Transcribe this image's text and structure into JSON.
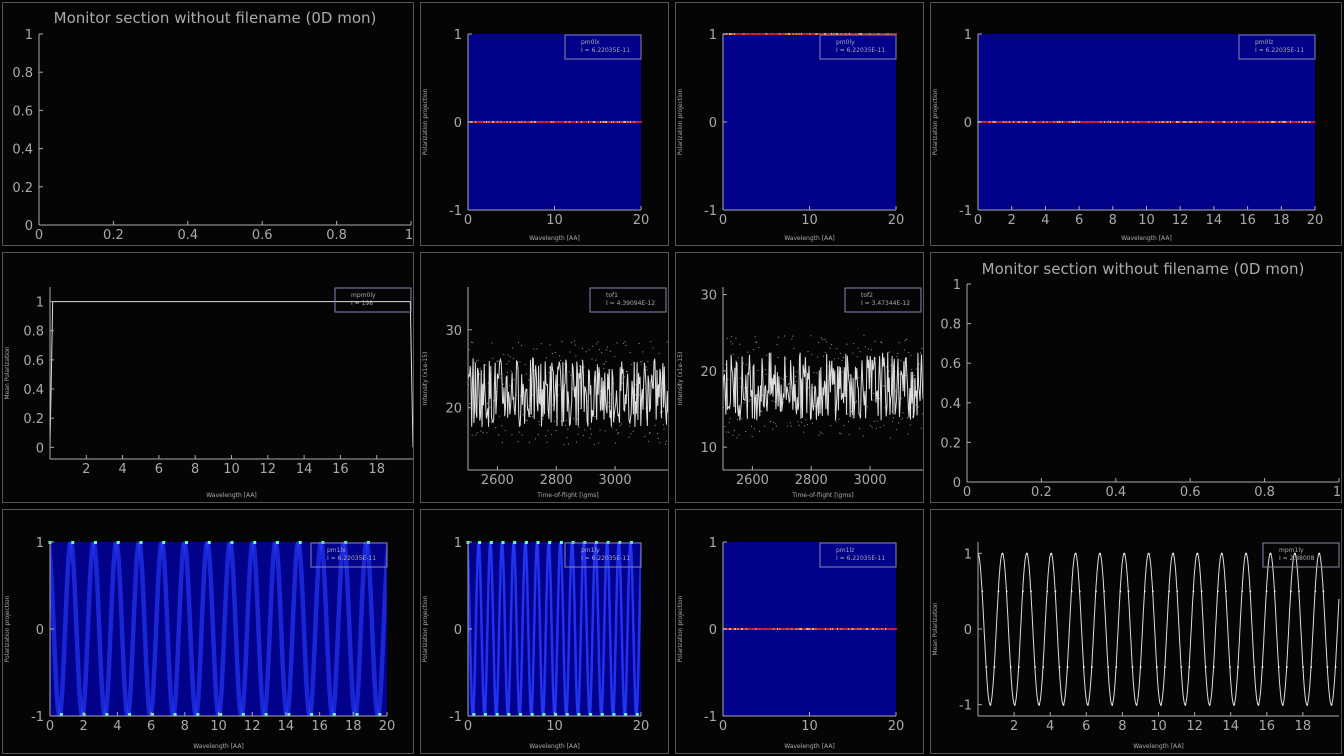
{
  "colors": {
    "background": "#000000",
    "axis": "#aaaaaa",
    "frame": "#555555",
    "heatmap_blue": "#01018a",
    "heatmap_red": "#ff2020",
    "polarization_blue": "#2a3cff",
    "line_white": "#dddddd"
  },
  "chart_data": [
    {
      "id": "p00",
      "type": "scatter",
      "title": "Monitor section without filename (0D mon)",
      "xlabel": "",
      "ylabel": "",
      "xlim": [
        0,
        1
      ],
      "ylim": [
        0,
        1
      ],
      "xticks": [
        "0",
        "0.2",
        "0.4",
        "0.6",
        "0.8",
        "1"
      ],
      "yticks": [
        "0",
        "0.2",
        "0.4",
        "0.6",
        "0.8",
        "1"
      ],
      "series": []
    },
    {
      "id": "p01",
      "type": "heatmap",
      "xlabel": "Wavelength [AA]",
      "ylabel": "Polarization projection",
      "xlim": [
        0,
        20
      ],
      "ylim": [
        -1,
        1
      ],
      "xticks": [
        "0",
        "10",
        "20"
      ],
      "yticks": [
        "-1",
        "0",
        "1"
      ],
      "legend": [
        "pm0lx",
        "I = 6.22035E-11"
      ],
      "legend_position": "top-right",
      "bands": [
        0
      ]
    },
    {
      "id": "p02",
      "type": "heatmap",
      "xlabel": "Wavelength [AA]",
      "ylabel": "Polarization projection",
      "xlim": [
        0,
        20
      ],
      "ylim": [
        -1,
        1
      ],
      "xticks": [
        "0",
        "10",
        "20"
      ],
      "yticks": [
        "-1",
        "0",
        "1"
      ],
      "legend": [
        "pm0ly",
        "I = 6.22035E-11"
      ],
      "legend_position": "top-right",
      "bands": [
        1
      ]
    },
    {
      "id": "p03",
      "type": "heatmap",
      "xlabel": "Wavelength [AA]",
      "ylabel": "Polarization projection",
      "xlim": [
        0,
        20
      ],
      "ylim": [
        -1,
        1
      ],
      "xticks": [
        "0",
        "2",
        "4",
        "6",
        "8",
        "10",
        "12",
        "14",
        "16",
        "18",
        "20"
      ],
      "yticks": [
        "-1",
        "0",
        "1"
      ],
      "legend": [
        "pm0lz",
        "I = 6.22035E-11"
      ],
      "legend_position": "top-right",
      "bands": [
        0
      ]
    },
    {
      "id": "p10",
      "type": "line",
      "xlabel": "Wavelength [AA]",
      "ylabel": "Mean Polarization",
      "xlim": [
        0,
        20
      ],
      "ylim": [
        -0.08,
        1.1
      ],
      "xticks": [
        "2",
        "4",
        "6",
        "8",
        "10",
        "12",
        "14",
        "16",
        "18"
      ],
      "yticks": [
        "0",
        "0.2",
        "0.4",
        "0.6",
        "0.8",
        "1"
      ],
      "legend": [
        "mpm0ly",
        "I = 198"
      ],
      "legend_position": "top-right",
      "series": [
        {
          "x": [
            0,
            0.15,
            19.85,
            20
          ],
          "y": [
            0,
            1,
            1,
            0
          ]
        }
      ]
    },
    {
      "id": "p11",
      "type": "line",
      "xlabel": "Time-of-flight [\\gms]",
      "ylabel": "Intensity (x1e-15)",
      "xlim": [
        2500,
        3180
      ],
      "ylim": [
        12,
        35.5
      ],
      "xticks": [
        "2600",
        "2800",
        "3000"
      ],
      "yticks": [
        "20",
        "30"
      ],
      "legend": [
        "tof1",
        "I = 4.39094E-12"
      ],
      "legend_position": "top-right",
      "mean": 22,
      "amplitude": 4.5
    },
    {
      "id": "p12",
      "type": "line",
      "xlabel": "Time-of-flight [\\gms]",
      "ylabel": "Intensity (x1e-15)",
      "xlim": [
        2500,
        3180
      ],
      "ylim": [
        7,
        31
      ],
      "xticks": [
        "2600",
        "2800",
        "3000"
      ],
      "yticks": [
        "10",
        "20",
        "30"
      ],
      "legend": [
        "tof2",
        "I = 3.47344E-12"
      ],
      "legend_position": "top-right",
      "mean": 18,
      "amplitude": 4.5
    },
    {
      "id": "p13",
      "type": "scatter",
      "title": "Monitor section without filename (0D mon)",
      "xlabel": "",
      "ylabel": "",
      "xlim": [
        0,
        1
      ],
      "ylim": [
        0,
        1
      ],
      "xticks": [
        "0",
        "0.2",
        "0.4",
        "0.6",
        "0.8",
        "1"
      ],
      "yticks": [
        "0",
        "0.2",
        "0.4",
        "0.6",
        "0.8",
        "1"
      ],
      "series": []
    },
    {
      "id": "p20",
      "type": "heatmap",
      "xlabel": "Wavelength [AA]",
      "ylabel": "Polarization projection",
      "xlim": [
        0,
        20
      ],
      "ylim": [
        -1,
        1
      ],
      "xticks": [
        "0",
        "2",
        "4",
        "6",
        "8",
        "10",
        "12",
        "14",
        "16",
        "18",
        "20"
      ],
      "yticks": [
        "-1",
        "0",
        "1"
      ],
      "legend": [
        "pm1lx",
        "I = 6.22035E-11"
      ],
      "legend_position": "top-right",
      "precession_period": 1.35
    },
    {
      "id": "p21",
      "type": "heatmap",
      "xlabel": "Wavelength [AA]",
      "ylabel": "Polarization projection",
      "xlim": [
        0,
        20
      ],
      "ylim": [
        -1,
        1
      ],
      "xticks": [
        "0",
        "10",
        "20"
      ],
      "yticks": [
        "-1",
        "0",
        "1"
      ],
      "legend": [
        "pm1ly",
        "I = 6.22035E-11"
      ],
      "legend_position": "top-right",
      "precession_period": 1.35
    },
    {
      "id": "p22",
      "type": "heatmap",
      "xlabel": "Wavelength [AA]",
      "ylabel": "Polarization projection",
      "xlim": [
        0,
        20
      ],
      "ylim": [
        -1,
        1
      ],
      "xticks": [
        "0",
        "10",
        "20"
      ],
      "yticks": [
        "-1",
        "0",
        "1"
      ],
      "legend": [
        "pm1lz",
        "I = 6.22035E-11"
      ],
      "legend_position": "top-right",
      "bands": [
        0
      ]
    },
    {
      "id": "p23",
      "type": "line",
      "xlabel": "Wavelength [AA]",
      "ylabel": "Mean Polarization",
      "xlim": [
        0,
        20
      ],
      "ylim": [
        -1.15,
        1.15
      ],
      "xticks": [
        "2",
        "4",
        "6",
        "8",
        "10",
        "12",
        "14",
        "16",
        "18"
      ],
      "yticks": [
        "-1",
        "0",
        "1"
      ],
      "legend": [
        "mpm1ly",
        "I = 2.88008"
      ],
      "legend_position": "top-right",
      "period": 1.35
    }
  ]
}
